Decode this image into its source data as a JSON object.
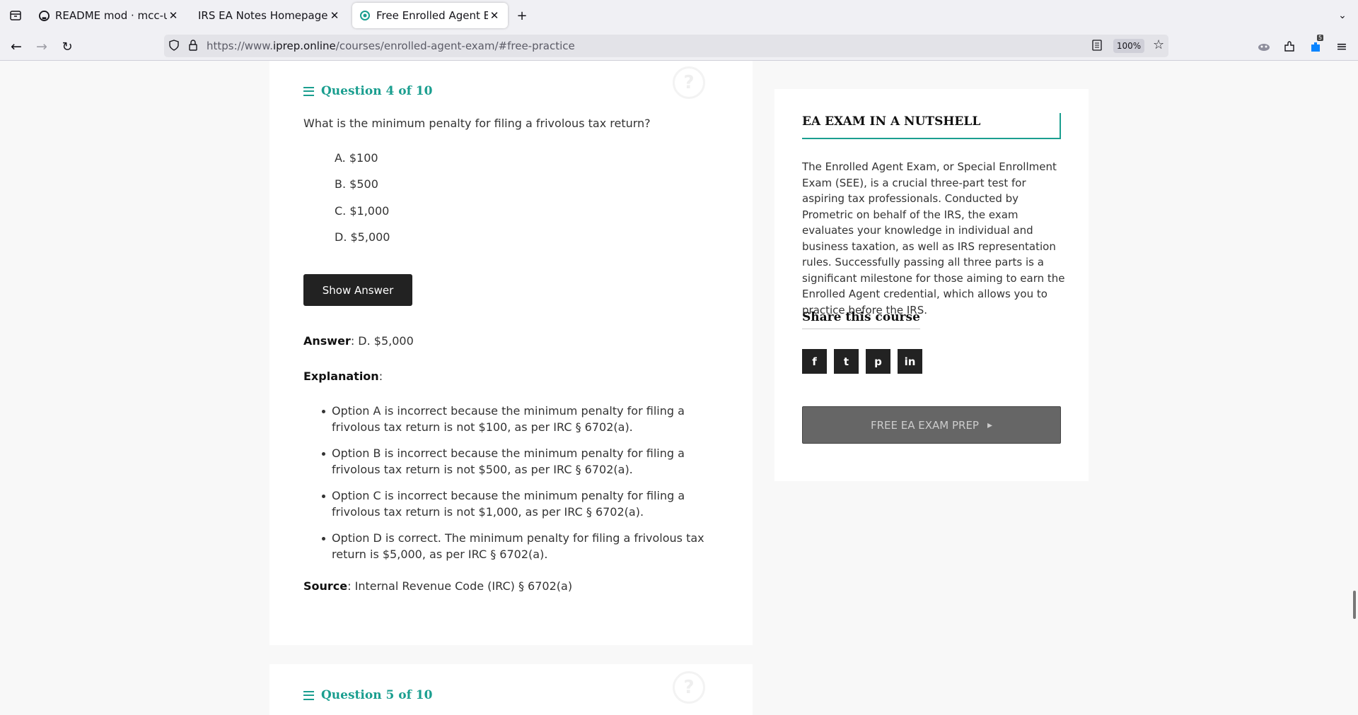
{
  "browser": {
    "tabs": [
      {
        "label": "README mod · mcc-us/i",
        "icon": "github-icon"
      },
      {
        "label": "IRS EA Notes Homepage · M",
        "icon": "none"
      },
      {
        "label": "Free Enrolled Agent Exan",
        "icon": "iprep-icon"
      }
    ],
    "url": {
      "prefix": "https://www.",
      "domain": "iprep.online",
      "path": "/courses/enrolled-agent-exam/#free-practice"
    },
    "zoom": "100%",
    "notification_count": "5"
  },
  "question4": {
    "heading": "Question 4 of 10",
    "text": "What is the minimum penalty for filing a frivolous tax return?",
    "options": [
      "A. $100",
      "B. $500",
      "C. $1,000",
      "D. $5,000"
    ],
    "show_answer": "Show Answer",
    "answer_label": "Answer",
    "answer_value": ": D. $5,000",
    "explanation_label": "Explanation",
    "explanation_suffix": ":",
    "explanations": [
      "Option A is incorrect because the minimum penalty for filing a frivolous tax return is not $100, as per IRC § 6702(a).",
      "Option B is incorrect because the minimum penalty for filing a frivolous tax return is not $500, as per IRC § 6702(a).",
      "Option C is incorrect because the minimum penalty for filing a frivolous tax return is not $1,000, as per IRC § 6702(a).",
      "Option D is correct. The minimum penalty for filing a frivolous tax return is $5,000, as per IRC § 6702(a)."
    ],
    "source_label": "Source",
    "source_value": ": Internal Revenue Code (IRC) § 6702(a)"
  },
  "question5": {
    "heading": "Question 5 of 10"
  },
  "sidebar": {
    "title": "EA EXAM IN A NUTSHELL",
    "description": "The Enrolled Agent Exam, or Special Enrollment Exam (SEE), is a crucial three-part test for aspiring tax professionals. Conducted by Prometric on behalf of the IRS, the exam evaluates your knowledge in individual and business taxation, as well as IRS representation rules. Successfully passing all three parts is a significant milestone for those aiming to earn the Enrolled Agent credential, which allows you to practice before the IRS.",
    "share_title": "Share this course",
    "social": [
      "f",
      "t",
      "p",
      "in"
    ],
    "cta": "FREE EA EXAM PREP",
    "cta_arrow": "▸"
  },
  "colors": {
    "accent": "#1a9e8f",
    "dark": "#222222"
  }
}
